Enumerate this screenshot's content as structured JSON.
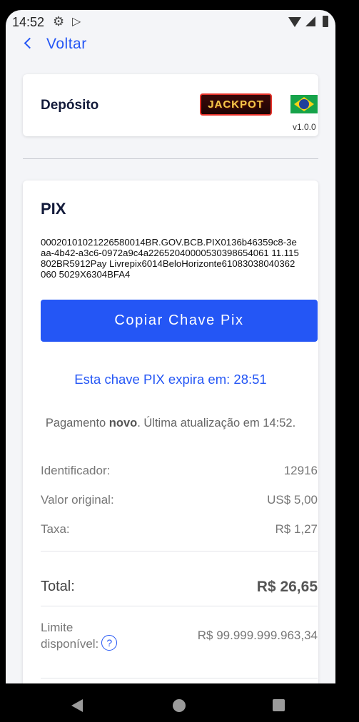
{
  "status_bar": {
    "time": "14:52"
  },
  "back": {
    "label": "Voltar"
  },
  "header_card": {
    "title": "Depósito",
    "logo_text": "JACKPOT",
    "version": "v1.0.0"
  },
  "pix": {
    "title": "PIX",
    "key": "00020101021226580014BR.GOV.BCB.PIX0136b46359c8-3eaa-4b42-a3c6-0972a9c4a22652040000530398654061 11.115802BR5912Pay Livrepix6014BeloHorizonte61083038040362060 5029X6304BFA4",
    "copy_button": "Copiar Chave Pix",
    "expire_text": "Esta chave PIX expira em: 28:51",
    "status_prefix": "Pagamento ",
    "status_bold": "novo",
    "status_suffix": ". Última atualização em 14:52.",
    "rows": [
      {
        "label": "Identificador:",
        "value": "12916"
      },
      {
        "label": "Valor original:",
        "value": "US$ 5,00"
      },
      {
        "label": "Taxa:",
        "value": "R$ 1,27"
      }
    ],
    "total": {
      "label": "Total:",
      "value": "R$ 26,65"
    },
    "limit": {
      "label_line1": "Limite",
      "label_line2": "disponível:",
      "help": "?",
      "value": "R$ 99.999.999.963,34"
    }
  },
  "colors": {
    "accent": "#2456f5",
    "background": "#f4f5f8",
    "heading": "#121a3a"
  }
}
